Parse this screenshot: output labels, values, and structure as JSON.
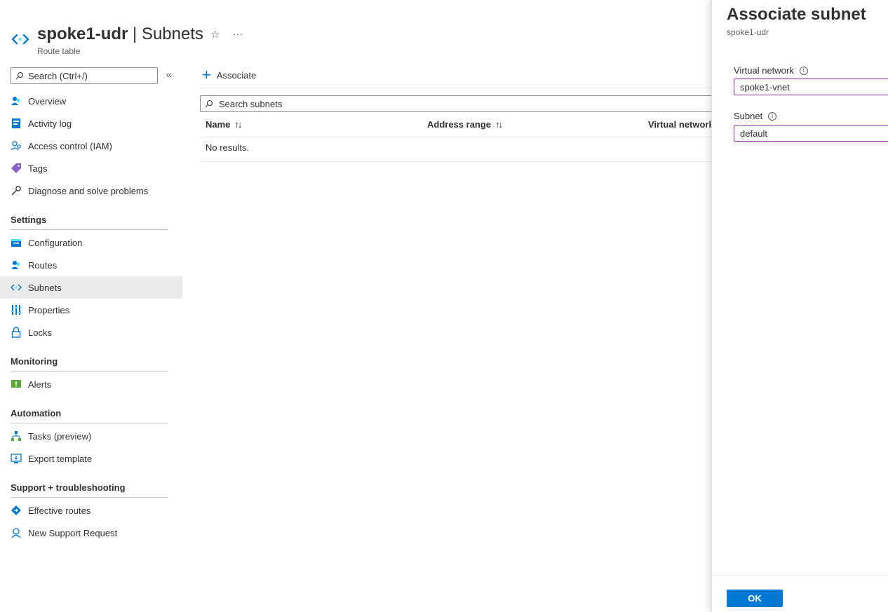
{
  "header": {
    "resource_name": "spoke1-udr",
    "separator": " | ",
    "page_name": "Subnets",
    "subtitle": "Route table",
    "favorite_icon": "star-icon",
    "more_label": "···"
  },
  "sidebar": {
    "search_placeholder": "Search (Ctrl+/)",
    "collapse_label": "«",
    "items_top": [
      {
        "label": "Overview",
        "icon": "overview-icon"
      },
      {
        "label": "Activity log",
        "icon": "activity-log-icon"
      },
      {
        "label": "Access control (IAM)",
        "icon": "iam-icon"
      },
      {
        "label": "Tags",
        "icon": "tag-icon"
      },
      {
        "label": "Diagnose and solve problems",
        "icon": "wrench-icon"
      }
    ],
    "sections": [
      {
        "title": "Settings",
        "items": [
          {
            "label": "Configuration",
            "icon": "configuration-icon"
          },
          {
            "label": "Routes",
            "icon": "routes-icon"
          },
          {
            "label": "Subnets",
            "icon": "subnet-icon",
            "active": true
          },
          {
            "label": "Properties",
            "icon": "properties-icon"
          },
          {
            "label": "Locks",
            "icon": "lock-icon"
          }
        ]
      },
      {
        "title": "Monitoring",
        "items": [
          {
            "label": "Alerts",
            "icon": "alert-icon"
          }
        ]
      },
      {
        "title": "Automation",
        "items": [
          {
            "label": "Tasks (preview)",
            "icon": "tasks-icon"
          },
          {
            "label": "Export template",
            "icon": "export-template-icon"
          }
        ]
      },
      {
        "title": "Support + troubleshooting",
        "items": [
          {
            "label": "Effective routes",
            "icon": "effective-routes-icon"
          },
          {
            "label": "New Support Request",
            "icon": "support-icon"
          }
        ]
      }
    ]
  },
  "main": {
    "associate_label": "Associate",
    "search_placeholder": "Search subnets",
    "columns": [
      "Name",
      "Address range",
      "Virtual network"
    ],
    "sort_glyph": "↑↓",
    "empty_text": "No results."
  },
  "panel": {
    "title": "Associate subnet",
    "subtitle": "spoke1-udr",
    "vnet_label": "Virtual network",
    "vnet_value": "spoke1-vnet",
    "subnet_label": "Subnet",
    "subnet_value": "default",
    "info_glyph": "i",
    "ok_label": "OK"
  },
  "colors": {
    "accent": "#0078d4",
    "field_border": "#8a2da5"
  }
}
